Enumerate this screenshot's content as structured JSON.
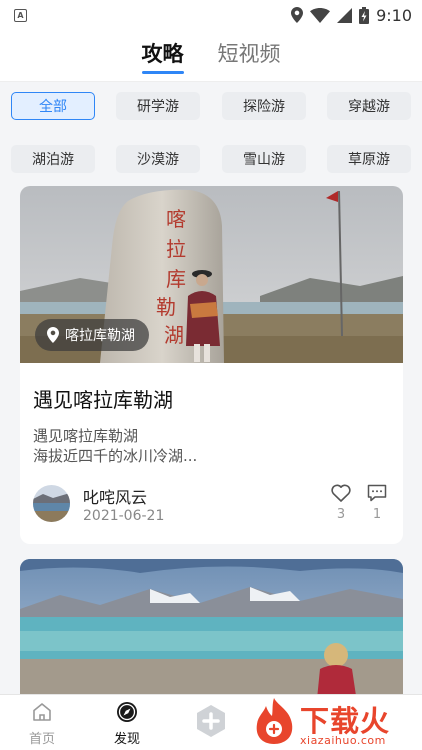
{
  "status_bar": {
    "time": "9:10",
    "notification_icon": "A"
  },
  "top_tabs": [
    {
      "label": "攻略",
      "active": true
    },
    {
      "label": "短视频",
      "active": false
    }
  ],
  "categories": [
    {
      "label": "全部",
      "active": true
    },
    {
      "label": "研学游",
      "active": false
    },
    {
      "label": "探险游",
      "active": false
    },
    {
      "label": "穿越游",
      "active": false
    },
    {
      "label": "湖泊游",
      "active": false
    },
    {
      "label": "沙漠游",
      "active": false
    },
    {
      "label": "雪山游",
      "active": false
    },
    {
      "label": "草原游",
      "active": false
    }
  ],
  "posts": [
    {
      "location": "喀拉库勒湖",
      "image_text": [
        "喀",
        "拉",
        "库",
        "勒",
        "湖"
      ],
      "title": "遇见喀拉库勒湖",
      "description": [
        "遇见喀拉库勒湖",
        "海拔近四千的冰川冷湖..."
      ],
      "author": "叱咤风云",
      "date": "2021-06-21",
      "likes": "3",
      "comments": "1"
    }
  ],
  "bottom_nav": [
    {
      "label": "首页",
      "icon": "home-icon"
    },
    {
      "label": "发现",
      "icon": "compass-icon"
    },
    {
      "label": "",
      "icon": "add-icon"
    }
  ],
  "watermark": {
    "title": "下载火",
    "subtitle": "xiazaihuo.com"
  },
  "colors": {
    "accent": "#2f86f6",
    "watermark": "#e8452c"
  }
}
